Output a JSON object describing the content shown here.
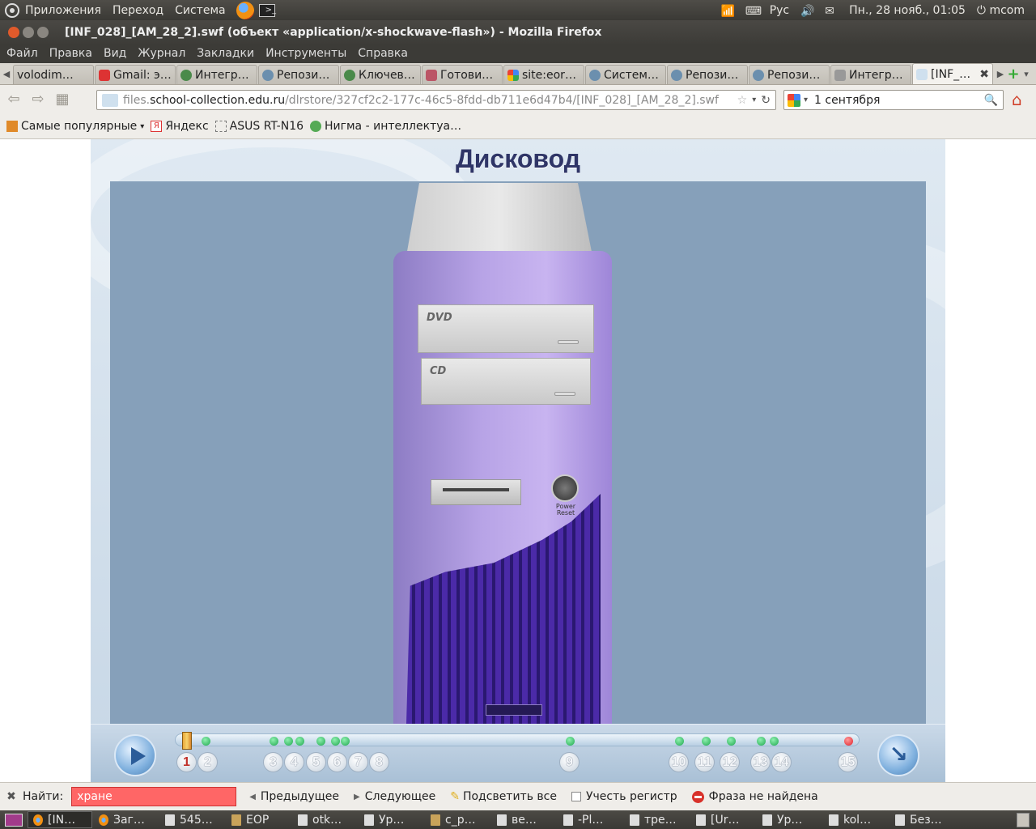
{
  "system_bar": {
    "menus": [
      "Приложения",
      "Переход",
      "Система"
    ],
    "lang": "Рус",
    "datetime": "Пн., 28 нояб., 01:05",
    "user": "mcom"
  },
  "window": {
    "title": "[INF_028]_[AM_28_2].swf (объект «application/x-shockwave-flash») - Mozilla Firefox"
  },
  "menubar": [
    "Файл",
    "Правка",
    "Вид",
    "Журнал",
    "Закладки",
    "Инструменты",
    "Справка"
  ],
  "tabs": [
    {
      "label": "volodim…"
    },
    {
      "label": "Gmail: э…"
    },
    {
      "label": "Интегр…"
    },
    {
      "label": "Репози…"
    },
    {
      "label": "Ключев…"
    },
    {
      "label": "Готови…"
    },
    {
      "label": "site:eor…"
    },
    {
      "label": "Систем…"
    },
    {
      "label": "Репози…"
    },
    {
      "label": "Репози…"
    },
    {
      "label": "Интегр…"
    },
    {
      "label": "[INF_…"
    }
  ],
  "address": {
    "prefix": "files.",
    "domain": "school-collection.edu.ru",
    "path": "/dlrstore/327cf2c2-177c-46c5-8fdd-db711e6d47b4/[INF_028]_[AM_28_2].swf"
  },
  "search": {
    "value": "1 сентября"
  },
  "bookmarks": [
    {
      "label": "Самые популярные"
    },
    {
      "label": "Яндекс"
    },
    {
      "label": "ASUS RT-N16"
    },
    {
      "label": "Нигма - интеллектуа…"
    }
  ],
  "flash": {
    "title": "Дисковод",
    "drive_labels": {
      "dvd": "DVD",
      "cd": "CD",
      "power": "Power",
      "reset": "Reset"
    },
    "current_page": 1,
    "pages": [
      "1",
      "2",
      "3",
      "4",
      "5",
      "6",
      "7",
      "8",
      "9",
      "10",
      "11",
      "12",
      "13",
      "14",
      "15"
    ]
  },
  "findbar": {
    "label": "Найти:",
    "query": "хране",
    "prev": "Предыдущее",
    "next": "Следующее",
    "highlight": "Подсветить все",
    "match_case": "Учесть регистр",
    "status": "Фраза не найдена"
  },
  "taskbar": [
    {
      "label": "[IN…",
      "kind": "ff"
    },
    {
      "label": "Заг…",
      "kind": "ff"
    },
    {
      "label": "545…",
      "kind": "doc"
    },
    {
      "label": "EOP",
      "kind": "folder"
    },
    {
      "label": "otk…",
      "kind": "doc"
    },
    {
      "label": "Ур…",
      "kind": "doc"
    },
    {
      "label": "c_p…",
      "kind": "folder"
    },
    {
      "label": "ве…",
      "kind": "doc"
    },
    {
      "label": "-Pl…",
      "kind": "doc"
    },
    {
      "label": "тре…",
      "kind": "doc"
    },
    {
      "label": "[Ur…",
      "kind": "doc"
    },
    {
      "label": "Ур…",
      "kind": "doc"
    },
    {
      "label": "kol…",
      "kind": "doc"
    },
    {
      "label": "Без…",
      "kind": "doc"
    }
  ]
}
